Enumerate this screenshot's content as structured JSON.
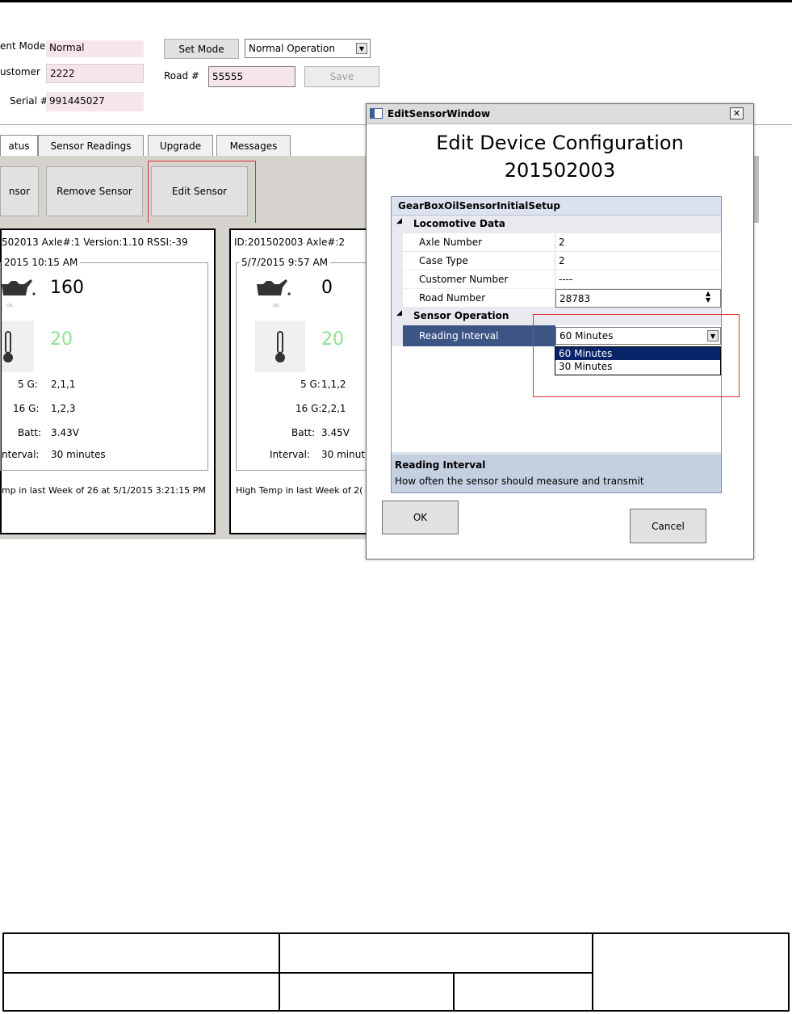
{
  "header": {
    "current_mode_label": "ent Mode",
    "current_mode_value": "Normal",
    "customer_label": "ustomer",
    "customer_value": "2222",
    "serial_label": "Serial #",
    "serial_value": "991445027",
    "set_mode_button": "Set Mode",
    "mode_select_value": "Normal Operation",
    "road_label": "Road #",
    "road_value": "55555",
    "save_button": "Save"
  },
  "tabs": [
    {
      "label": "atus"
    },
    {
      "label": "Sensor Readings"
    },
    {
      "label": "Upgrade"
    },
    {
      "label": "Messages"
    }
  ],
  "toolbar": {
    "add_sensor_button": "nsor",
    "remove_sensor_button": "Remove Sensor",
    "edit_sensor_button": "Edit Sensor"
  },
  "cards": [
    {
      "header": "502013  Axle#:1  Version:1.10  RSSI:-39",
      "datetime": "2015 10:15 AM",
      "oil_value": "160",
      "temp_value": "20",
      "g5_label": "5 G:",
      "g5_value": "2,1,1",
      "g16_label": "16 G:",
      "g16_value": "1,2,3",
      "batt_label": "Batt:",
      "batt_value": "3.43V",
      "interval_label": "nterval:",
      "interval_value": "30 minutes",
      "footer": "mp in last Week of 26 at 5/1/2015 3:21:15 PM"
    },
    {
      "header": "ID:201502003  Axle#:2",
      "datetime": "5/7/2015 9:57 AM",
      "oil_value": "0",
      "temp_value": "20",
      "g5_label": "5 G:",
      "g5_value": "1,1,2",
      "g16_label": "16 G:",
      "g16_value": "2,2,1",
      "batt_label": "Batt:",
      "batt_value": "3.45V",
      "interval_label": "Interval:",
      "interval_value": "30 minut",
      "footer": "High Temp in last Week of 2("
    }
  ],
  "dialog": {
    "window_title": "EditSensorWindow",
    "close_glyph": "✕",
    "heading": "Edit Device Configuration",
    "device_id": "201502003",
    "grid_title": "GearBoxOilSensorInitialSetup",
    "category_locomotive": "Locomotive Data",
    "rows": [
      {
        "name": "Axle Number",
        "value": "2"
      },
      {
        "name": "Case Type",
        "value": "2"
      },
      {
        "name": "Customer Number",
        "value": "----"
      },
      {
        "name": "Road Number",
        "value": "28783"
      }
    ],
    "category_sensor": "Sensor Operation",
    "reading_interval_name": "Reading Interval",
    "reading_interval_value": "60 Minutes",
    "dropdown_options": [
      "60 Minutes",
      "30 Minutes"
    ],
    "help_title": "Reading Interval",
    "help_text": "How often the sensor should measure and transmit",
    "ok_button": "OK",
    "cancel_button": "Cancel"
  },
  "colors": {
    "pink_field": "#f7e6e9",
    "panel_gray": "#d6d3ce",
    "highlight_red": "#e03030",
    "selected_row": "#3d5585",
    "dropdown_selected": "#0a246a",
    "temp_green": "#8ee08e"
  },
  "icons": [
    "oil-can-icon",
    "thermometer-icon",
    "window-app-icon",
    "close-icon",
    "dropdown-arrow-icon",
    "spinner-icon",
    "collapse-triangle-icon"
  ]
}
